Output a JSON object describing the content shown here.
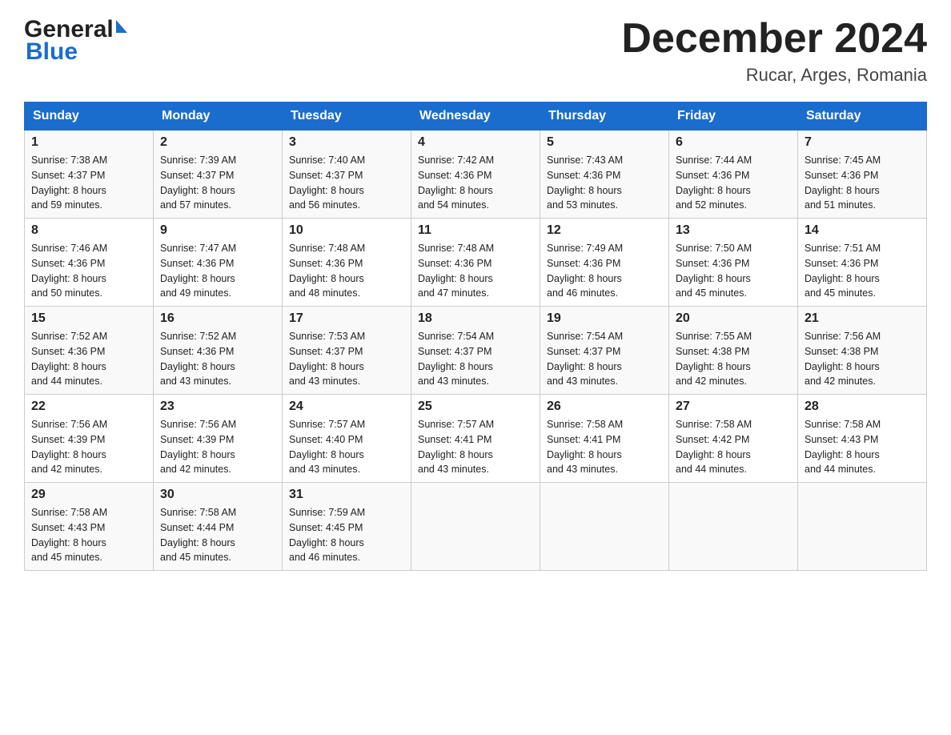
{
  "header": {
    "month_title": "December 2024",
    "location": "Rucar, Arges, Romania",
    "logo_general": "General",
    "logo_blue": "Blue"
  },
  "days_of_week": [
    "Sunday",
    "Monday",
    "Tuesday",
    "Wednesday",
    "Thursday",
    "Friday",
    "Saturday"
  ],
  "weeks": [
    [
      {
        "day": "1",
        "sunrise": "7:38 AM",
        "sunset": "4:37 PM",
        "daylight": "8 hours and 59 minutes."
      },
      {
        "day": "2",
        "sunrise": "7:39 AM",
        "sunset": "4:37 PM",
        "daylight": "8 hours and 57 minutes."
      },
      {
        "day": "3",
        "sunrise": "7:40 AM",
        "sunset": "4:37 PM",
        "daylight": "8 hours and 56 minutes."
      },
      {
        "day": "4",
        "sunrise": "7:42 AM",
        "sunset": "4:36 PM",
        "daylight": "8 hours and 54 minutes."
      },
      {
        "day": "5",
        "sunrise": "7:43 AM",
        "sunset": "4:36 PM",
        "daylight": "8 hours and 53 minutes."
      },
      {
        "day": "6",
        "sunrise": "7:44 AM",
        "sunset": "4:36 PM",
        "daylight": "8 hours and 52 minutes."
      },
      {
        "day": "7",
        "sunrise": "7:45 AM",
        "sunset": "4:36 PM",
        "daylight": "8 hours and 51 minutes."
      }
    ],
    [
      {
        "day": "8",
        "sunrise": "7:46 AM",
        "sunset": "4:36 PM",
        "daylight": "8 hours and 50 minutes."
      },
      {
        "day": "9",
        "sunrise": "7:47 AM",
        "sunset": "4:36 PM",
        "daylight": "8 hours and 49 minutes."
      },
      {
        "day": "10",
        "sunrise": "7:48 AM",
        "sunset": "4:36 PM",
        "daylight": "8 hours and 48 minutes."
      },
      {
        "day": "11",
        "sunrise": "7:48 AM",
        "sunset": "4:36 PM",
        "daylight": "8 hours and 47 minutes."
      },
      {
        "day": "12",
        "sunrise": "7:49 AM",
        "sunset": "4:36 PM",
        "daylight": "8 hours and 46 minutes."
      },
      {
        "day": "13",
        "sunrise": "7:50 AM",
        "sunset": "4:36 PM",
        "daylight": "8 hours and 45 minutes."
      },
      {
        "day": "14",
        "sunrise": "7:51 AM",
        "sunset": "4:36 PM",
        "daylight": "8 hours and 45 minutes."
      }
    ],
    [
      {
        "day": "15",
        "sunrise": "7:52 AM",
        "sunset": "4:36 PM",
        "daylight": "8 hours and 44 minutes."
      },
      {
        "day": "16",
        "sunrise": "7:52 AM",
        "sunset": "4:36 PM",
        "daylight": "8 hours and 43 minutes."
      },
      {
        "day": "17",
        "sunrise": "7:53 AM",
        "sunset": "4:37 PM",
        "daylight": "8 hours and 43 minutes."
      },
      {
        "day": "18",
        "sunrise": "7:54 AM",
        "sunset": "4:37 PM",
        "daylight": "8 hours and 43 minutes."
      },
      {
        "day": "19",
        "sunrise": "7:54 AM",
        "sunset": "4:37 PM",
        "daylight": "8 hours and 43 minutes."
      },
      {
        "day": "20",
        "sunrise": "7:55 AM",
        "sunset": "4:38 PM",
        "daylight": "8 hours and 42 minutes."
      },
      {
        "day": "21",
        "sunrise": "7:56 AM",
        "sunset": "4:38 PM",
        "daylight": "8 hours and 42 minutes."
      }
    ],
    [
      {
        "day": "22",
        "sunrise": "7:56 AM",
        "sunset": "4:39 PM",
        "daylight": "8 hours and 42 minutes."
      },
      {
        "day": "23",
        "sunrise": "7:56 AM",
        "sunset": "4:39 PM",
        "daylight": "8 hours and 42 minutes."
      },
      {
        "day": "24",
        "sunrise": "7:57 AM",
        "sunset": "4:40 PM",
        "daylight": "8 hours and 43 minutes."
      },
      {
        "day": "25",
        "sunrise": "7:57 AM",
        "sunset": "4:41 PM",
        "daylight": "8 hours and 43 minutes."
      },
      {
        "day": "26",
        "sunrise": "7:58 AM",
        "sunset": "4:41 PM",
        "daylight": "8 hours and 43 minutes."
      },
      {
        "day": "27",
        "sunrise": "7:58 AM",
        "sunset": "4:42 PM",
        "daylight": "8 hours and 44 minutes."
      },
      {
        "day": "28",
        "sunrise": "7:58 AM",
        "sunset": "4:43 PM",
        "daylight": "8 hours and 44 minutes."
      }
    ],
    [
      {
        "day": "29",
        "sunrise": "7:58 AM",
        "sunset": "4:43 PM",
        "daylight": "8 hours and 45 minutes."
      },
      {
        "day": "30",
        "sunrise": "7:58 AM",
        "sunset": "4:44 PM",
        "daylight": "8 hours and 45 minutes."
      },
      {
        "day": "31",
        "sunrise": "7:59 AM",
        "sunset": "4:45 PM",
        "daylight": "8 hours and 46 minutes."
      },
      null,
      null,
      null,
      null
    ]
  ],
  "labels": {
    "sunrise": "Sunrise:",
    "sunset": "Sunset:",
    "daylight": "Daylight:"
  }
}
